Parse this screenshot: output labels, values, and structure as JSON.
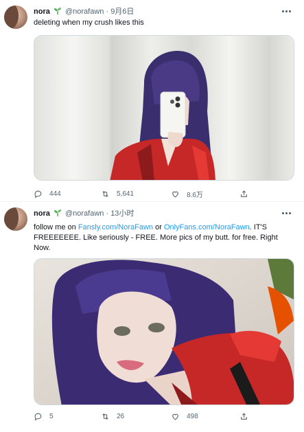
{
  "tweets": [
    {
      "name": "nora",
      "handle": "@norafawn",
      "separator": "·",
      "time": "9月6日",
      "text": "deleting when my crush likes this",
      "stats": {
        "replies": "444",
        "retweets": "5,641",
        "likes": "8.6万"
      }
    },
    {
      "name": "nora",
      "handle": "@norafawn",
      "separator": "·",
      "time": "13小时",
      "text": {
        "part1": "follow me on ",
        "link1": "Fansly.com/NoraFawn",
        "part2": " or ",
        "link2": "OnlyFans.com/NoraFawn",
        "part3": ". IT'S FREEEEEEE. Like seriously - FREE. More pics of my butt. for free. Right Now."
      },
      "stats": {
        "replies": "5",
        "retweets": "26",
        "likes": "498"
      }
    }
  ],
  "icons": {
    "reply": "reply-icon",
    "retweet": "retweet-icon",
    "like": "heart-icon",
    "share": "share-icon",
    "more": "more-icon",
    "badge": "sprout-icon"
  },
  "colors": {
    "link": "#1d9bf0",
    "secondary": "#536471",
    "badge": "#3a9d3a"
  }
}
